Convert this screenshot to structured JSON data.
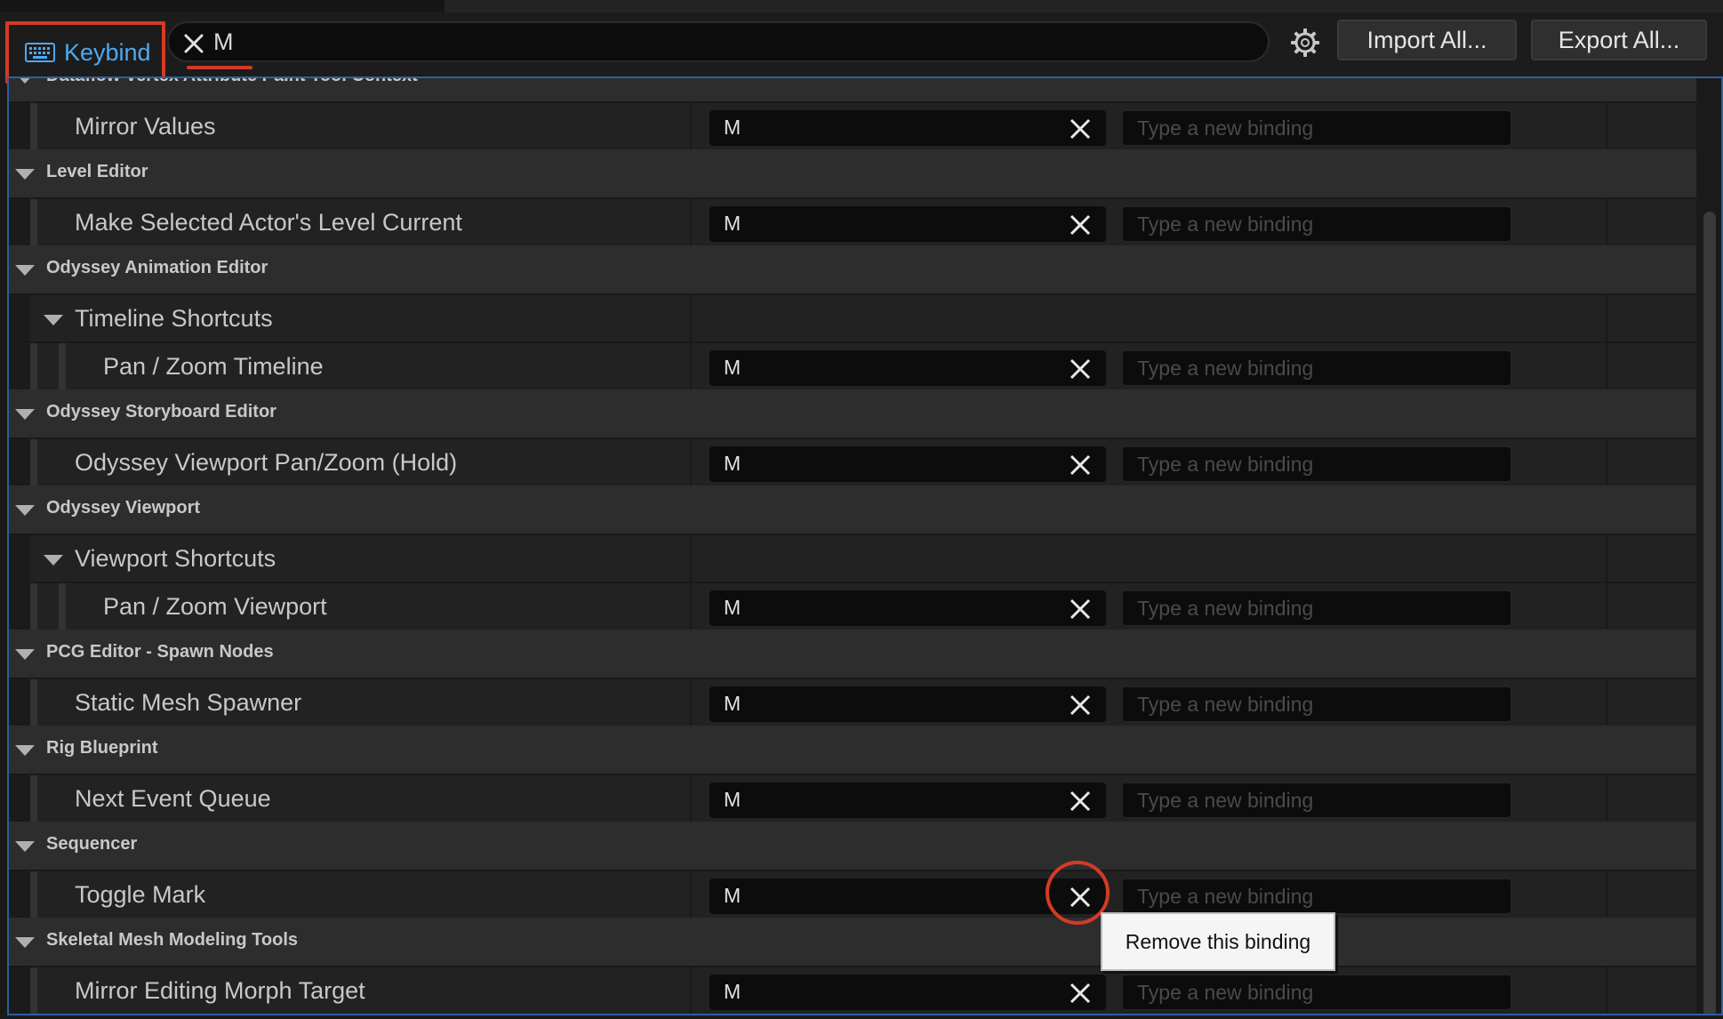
{
  "toolbar": {
    "keybind_label": "Keybind",
    "search_value": "M",
    "import_label": "Import All...",
    "export_label": "Export All..."
  },
  "rows": {
    "r0": {
      "label": "Dataflow Vertex Attribute Paint Tool Context"
    },
    "r1": {
      "label": "Mirror Values",
      "binding": "M"
    },
    "r2": {
      "label": "Level Editor"
    },
    "r3": {
      "label": "Make Selected Actor's Level Current",
      "binding": "M"
    },
    "r4": {
      "label": "Odyssey Animation Editor"
    },
    "r5": {
      "label": "Timeline Shortcuts"
    },
    "r6": {
      "label": "Pan / Zoom Timeline",
      "binding": "M"
    },
    "r7": {
      "label": "Odyssey Storyboard Editor"
    },
    "r8": {
      "label": "Odyssey Viewport Pan/Zoom (Hold)",
      "binding": "M"
    },
    "r9": {
      "label": "Odyssey Viewport"
    },
    "r10": {
      "label": "Viewport Shortcuts"
    },
    "r11": {
      "label": "Pan / Zoom Viewport",
      "binding": "M"
    },
    "r12": {
      "label": "PCG Editor - Spawn Nodes"
    },
    "r13": {
      "label": "Static Mesh Spawner",
      "binding": "M"
    },
    "r14": {
      "label": "Rig Blueprint"
    },
    "r15": {
      "label": "Next Event Queue",
      "binding": "M"
    },
    "r16": {
      "label": "Sequencer"
    },
    "r17": {
      "label": "Toggle Mark",
      "binding": "M"
    },
    "r18": {
      "label": "Skeletal Mesh Modeling Tools"
    },
    "r19": {
      "label": "Mirror Editing Morph Target",
      "binding": "M"
    }
  },
  "new_binding_placeholder": "Type a new binding",
  "tooltip": "Remove this binding",
  "colors": {
    "accent_blue": "#4ea9f0",
    "highlight_red": "#d43a26",
    "panel_border": "#2f5f9e"
  }
}
